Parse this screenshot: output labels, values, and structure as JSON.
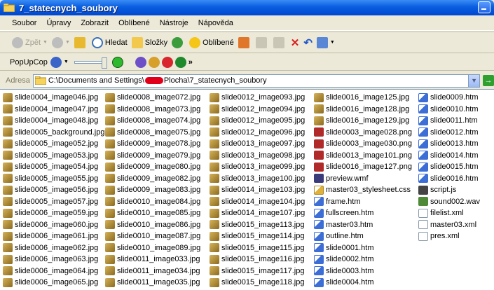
{
  "window": {
    "title": "7_statecnych_soubory"
  },
  "menu": [
    "Soubor",
    "Úpravy",
    "Zobrazit",
    "Oblíbené",
    "Nástroje",
    "Nápověda"
  ],
  "toolbar": {
    "back": "Zpět",
    "search": "Hledat",
    "folders": "Složky",
    "favorites": "Oblíbené"
  },
  "popup": {
    "label": "PopUpCop"
  },
  "address": {
    "label": "Adresa",
    "path_start": "C:\\Documents and Settings\\",
    "path_end": "Plocha\\7_statecnych_soubory"
  },
  "files": {
    "col1": [
      {
        "name": "slide0004_image046.jpg",
        "type": "jpg"
      },
      {
        "name": "slide0004_image047.jpg",
        "type": "jpg"
      },
      {
        "name": "slide0004_image048.jpg",
        "type": "jpg"
      },
      {
        "name": "slide0005_background.jpg",
        "type": "jpg"
      },
      {
        "name": "slide0005_image052.jpg",
        "type": "jpg"
      },
      {
        "name": "slide0005_image053.jpg",
        "type": "jpg"
      },
      {
        "name": "slide0005_image054.jpg",
        "type": "jpg"
      },
      {
        "name": "slide0005_image055.jpg",
        "type": "jpg"
      },
      {
        "name": "slide0005_image056.jpg",
        "type": "jpg"
      },
      {
        "name": "slide0005_image057.jpg",
        "type": "jpg"
      },
      {
        "name": "slide0006_image059.jpg",
        "type": "jpg"
      },
      {
        "name": "slide0006_image060.jpg",
        "type": "jpg"
      },
      {
        "name": "slide0006_image061.jpg",
        "type": "jpg"
      },
      {
        "name": "slide0006_image062.jpg",
        "type": "jpg"
      },
      {
        "name": "slide0006_image063.jpg",
        "type": "jpg"
      },
      {
        "name": "slide0006_image064.jpg",
        "type": "jpg"
      },
      {
        "name": "slide0006_image065.jpg",
        "type": "jpg"
      }
    ],
    "col2": [
      {
        "name": "slide0008_image072.jpg",
        "type": "jpg"
      },
      {
        "name": "slide0008_image073.jpg",
        "type": "jpg"
      },
      {
        "name": "slide0008_image074.jpg",
        "type": "jpg"
      },
      {
        "name": "slide0008_image075.jpg",
        "type": "jpg"
      },
      {
        "name": "slide0009_image078.jpg",
        "type": "jpg"
      },
      {
        "name": "slide0009_image079.jpg",
        "type": "jpg"
      },
      {
        "name": "slide0009_image080.jpg",
        "type": "jpg"
      },
      {
        "name": "slide0009_image082.jpg",
        "type": "jpg"
      },
      {
        "name": "slide0009_image083.jpg",
        "type": "jpg"
      },
      {
        "name": "slide0010_image084.jpg",
        "type": "jpg"
      },
      {
        "name": "slide0010_image085.jpg",
        "type": "jpg"
      },
      {
        "name": "slide0010_image086.jpg",
        "type": "jpg"
      },
      {
        "name": "slide0010_image087.jpg",
        "type": "jpg"
      },
      {
        "name": "slide0010_image089.jpg",
        "type": "jpg"
      },
      {
        "name": "slide0011_image033.jpg",
        "type": "jpg"
      },
      {
        "name": "slide0011_image034.jpg",
        "type": "jpg"
      },
      {
        "name": "slide0011_image035.jpg",
        "type": "jpg"
      }
    ],
    "col3": [
      {
        "name": "slide0012_image093.jpg",
        "type": "jpg"
      },
      {
        "name": "slide0012_image094.jpg",
        "type": "jpg"
      },
      {
        "name": "slide0012_image095.jpg",
        "type": "jpg"
      },
      {
        "name": "slide0012_image096.jpg",
        "type": "jpg"
      },
      {
        "name": "slide0013_image097.jpg",
        "type": "jpg"
      },
      {
        "name": "slide0013_image098.jpg",
        "type": "jpg"
      },
      {
        "name": "slide0013_image099.jpg",
        "type": "jpg"
      },
      {
        "name": "slide0013_image100.jpg",
        "type": "jpg"
      },
      {
        "name": "slide0014_image103.jpg",
        "type": "jpg"
      },
      {
        "name": "slide0014_image104.jpg",
        "type": "jpg"
      },
      {
        "name": "slide0014_image107.jpg",
        "type": "jpg"
      },
      {
        "name": "slide0015_image113.jpg",
        "type": "jpg"
      },
      {
        "name": "slide0015_image114.jpg",
        "type": "jpg"
      },
      {
        "name": "slide0015_image115.jpg",
        "type": "jpg"
      },
      {
        "name": "slide0015_image116.jpg",
        "type": "jpg"
      },
      {
        "name": "slide0015_image117.jpg",
        "type": "jpg"
      },
      {
        "name": "slide0015_image118.jpg",
        "type": "jpg"
      }
    ],
    "col4": [
      {
        "name": "slide0016_image125.jpg",
        "type": "jpg"
      },
      {
        "name": "slide0016_image128.jpg",
        "type": "jpg"
      },
      {
        "name": "slide0016_image129.jpg",
        "type": "jpg"
      },
      {
        "name": "slide0003_image028.png",
        "type": "png"
      },
      {
        "name": "slide0003_image030.png",
        "type": "png"
      },
      {
        "name": "slide0013_image101.png",
        "type": "png"
      },
      {
        "name": "slide0016_image127.png",
        "type": "png"
      },
      {
        "name": "preview.wmf",
        "type": "wmf"
      },
      {
        "name": "master03_stylesheet.css",
        "type": "css"
      },
      {
        "name": "frame.htm",
        "type": "htm"
      },
      {
        "name": "fullscreen.htm",
        "type": "htm"
      },
      {
        "name": "master03.htm",
        "type": "htm"
      },
      {
        "name": "outline.htm",
        "type": "htm"
      },
      {
        "name": "slide0001.htm",
        "type": "htm"
      },
      {
        "name": "slide0002.htm",
        "type": "htm"
      },
      {
        "name": "slide0003.htm",
        "type": "htm"
      },
      {
        "name": "slide0004.htm",
        "type": "htm"
      }
    ],
    "col5": [
      {
        "name": "slide0009.htm",
        "type": "htm"
      },
      {
        "name": "slide0010.htm",
        "type": "htm"
      },
      {
        "name": "slide0011.htm",
        "type": "htm"
      },
      {
        "name": "slide0012.htm",
        "type": "htm"
      },
      {
        "name": "slide0013.htm",
        "type": "htm"
      },
      {
        "name": "slide0014.htm",
        "type": "htm"
      },
      {
        "name": "slide0015.htm",
        "type": "htm"
      },
      {
        "name": "slide0016.htm",
        "type": "htm"
      },
      {
        "name": "script.js",
        "type": "js"
      },
      {
        "name": "sound002.wav",
        "type": "wav"
      },
      {
        "name": "filelist.xml",
        "type": "xml"
      },
      {
        "name": "master03.xml",
        "type": "xml"
      },
      {
        "name": "pres.xml",
        "type": "xml"
      }
    ]
  }
}
